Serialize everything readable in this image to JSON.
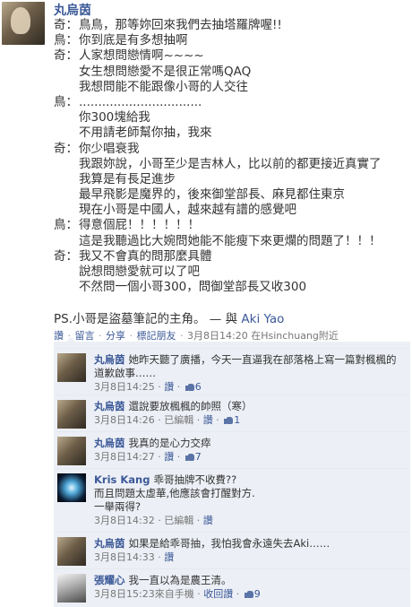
{
  "post": {
    "author": "丸烏茵",
    "lines": [
      {
        "speaker": "奇：",
        "text": "鳥鳥，那等妳回來我們去抽塔羅牌喔!!"
      },
      {
        "speaker": "鳥：",
        "text": "你到底是有多想抽啊"
      },
      {
        "speaker": "奇：",
        "text": "人家想問戀情啊~~~~"
      },
      {
        "speaker": "",
        "text": "女生想問戀愛不是很正常嗎QAQ"
      },
      {
        "speaker": "",
        "text": "我想問能不能跟像小哥的人交往"
      },
      {
        "speaker": "鳥：",
        "text": "................................"
      },
      {
        "speaker": "",
        "text": "你300塊給我"
      },
      {
        "speaker": "",
        "text": "不用請老師幫你抽，我來"
      },
      {
        "speaker": "奇：",
        "text": "你少唱衰我"
      },
      {
        "speaker": "",
        "text": "我跟妳說，小哥至少是吉林人，比以前的都更接近真實了"
      },
      {
        "speaker": "",
        "text": "我算是有長足進步"
      },
      {
        "speaker": "",
        "text": "最早飛影是魔界的，後來御堂部長、麻見都住東京"
      },
      {
        "speaker": "",
        "text": "現在小哥是中國人，越來越有譜的感覺吧"
      },
      {
        "speaker": "鳥：",
        "text": "得意個屁！！！！！！"
      },
      {
        "speaker": "",
        "text": "這是我聽過比大婉問她能不能瘦下來更爛的問題了！！！"
      },
      {
        "speaker": "奇：",
        "text": "我又不會真的問那麼具體"
      },
      {
        "speaker": "",
        "text": "說想問戀愛就可以了吧"
      },
      {
        "speaker": "",
        "text": "不然問一個小哥300，問御堂部長又收300"
      }
    ],
    "ps": "PS.小哥是盜墓筆記的主角。",
    "with_prefix": " — 與 ",
    "tagged_user": "Aki Yao",
    "meta": {
      "like": "讚",
      "comment": "留言",
      "share": "分享",
      "tag": "標記朋友",
      "time": "3月8日14:20",
      "location": "在Hsinchuang附近",
      "sep": " · ",
      "dot": "·"
    }
  },
  "comments": [
    {
      "author": "丸烏茵",
      "text": "她昨天聽了廣播，今天一直逼我在部落格上寫一篇對楓楓的道歉啟事……",
      "time": "3月8日14:25",
      "extra": "",
      "like_label": "讚",
      "likes": "6"
    },
    {
      "author": "丸烏茵",
      "text": "還說要放楓楓的帥照（寒）",
      "time": "3月8日14:26",
      "extra": "已編輯",
      "like_label": "讚",
      "likes": "1"
    },
    {
      "author": "丸烏茵",
      "text": "我真的是心力交瘁",
      "time": "3月8日14:27",
      "extra": "",
      "like_label": "讚",
      "likes": "7"
    },
    {
      "author": "Kris Kang",
      "text": "乖哥抽牌不收費??",
      "text2": "而且問題太虛華,他應該會打醒對方.",
      "text3": "一舉兩得?",
      "time": "3月8日14:32",
      "extra": "已編輯",
      "like_label": "讚",
      "likes": ""
    },
    {
      "author": "丸烏茵",
      "text": "如果是給乖哥抽，我怕我會永遠失去Aki……",
      "time": "3月8日14:33",
      "extra": "",
      "like_label": "讚",
      "likes": ""
    },
    {
      "author": "張耀心",
      "text": "我一直以為是農王清。",
      "time": "3月8日15:23",
      "extra": "來自手機",
      "unlike": "收回讚",
      "like_label": "",
      "likes": "9"
    }
  ]
}
